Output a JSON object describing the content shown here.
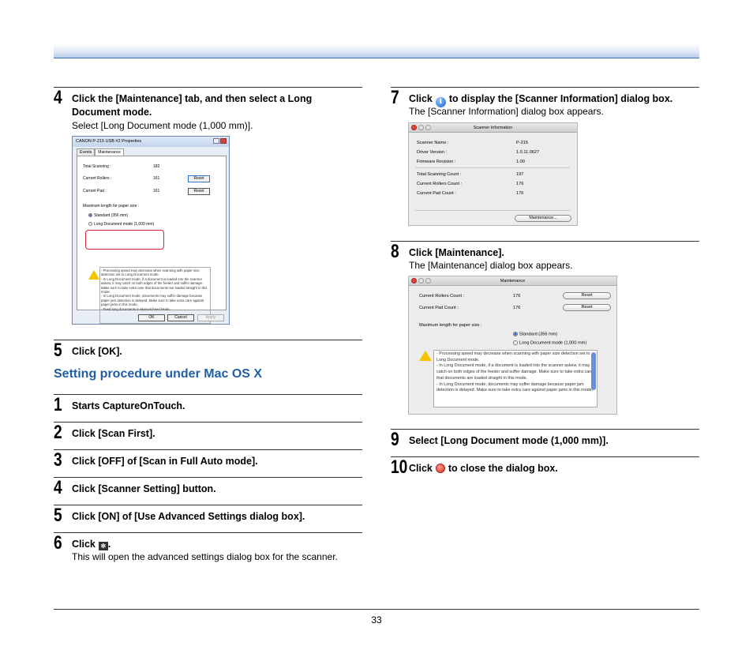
{
  "left_steps": [
    {
      "num": "4",
      "title": "Click the [Maintenance] tab, and then select a Long Document mode.",
      "desc": "Select [Long Document mode (1,000 mm)]."
    },
    {
      "num": "5",
      "title": "Click [OK]."
    }
  ],
  "section_heading": "Setting procedure under Mac OS X",
  "mac_steps": [
    {
      "num": "1",
      "title": "Starts CaptureOnTouch."
    },
    {
      "num": "2",
      "title": "Click [Scan First]."
    },
    {
      "num": "3",
      "title": "Click [OFF] of [Scan in Full Auto mode]."
    },
    {
      "num": "4",
      "title": "Click [Scanner Setting] button."
    },
    {
      "num": "5",
      "title": "Click [ON] of [Use Advanced Settings dialog box]."
    },
    {
      "num": "6",
      "title_prefix": "Click",
      "title_suffix": ".",
      "desc": "This will open the advanced settings dialog box for the scanner."
    }
  ],
  "right_steps": [
    {
      "num": "7",
      "title_prefix": "Click",
      "title_suffix": "to display the [Scanner Information] dialog box.",
      "desc": "The [Scanner Information] dialog box appears."
    },
    {
      "num": "8",
      "title": "Click [Maintenance].",
      "desc": "The [Maintenance] dialog box appears."
    },
    {
      "num": "9",
      "title": "Select [Long Document mode (1,000 mm)]."
    },
    {
      "num": "10",
      "title_prefix": "Click",
      "title_suffix": "to close the dialog box."
    }
  ],
  "win_dialog": {
    "title": "CANON P-215 USB #2 Properties",
    "tabs": [
      "Events",
      "Maintenance"
    ],
    "rows": [
      {
        "label": "Total Scanning :",
        "value": "182"
      },
      {
        "label": "Current Rollers :",
        "value": "161",
        "button": "Reset"
      },
      {
        "label": "Current Pad :",
        "value": "161",
        "button": "Reset"
      }
    ],
    "max_length_label": "Maximum length for paper size :",
    "radio_standard": "Standard (356 mm)",
    "radio_long": "Long Document mode (1,000 mm)",
    "warning": "- Processing speed may decrease when scanning with paper size detection set to Long Document mode.\n- In Long Document mode, if a document is loaded into the scanner askew, it may catch on both edges of the feeder and suffer damage. Make sure to take extra care that documents are loaded straight in this mode.\n- In Long Document mode, documents may suffer damage because paper jam detection is delayed. Make sure to take extra care against paper jams in this mode.\n- Feed long documents in Manual Feed Mode.",
    "ok": "OK",
    "cancel": "Cancel",
    "apply": "Apply"
  },
  "scanner_info": {
    "title": "Scanner Information",
    "rows": [
      {
        "label": "Scanner Name :",
        "value": "P-215"
      },
      {
        "label": "Driver Version :",
        "value": "1.0.11.0627"
      },
      {
        "label": "Firmware Revision :",
        "value": "1.00"
      },
      {
        "label": "Total Scanning Count :",
        "value": "197"
      },
      {
        "label": "Current Rollers Count :",
        "value": "176"
      },
      {
        "label": "Current Pad Count :",
        "value": "176"
      }
    ],
    "button": "Maintenance..."
  },
  "maintenance": {
    "title": "Maintenance",
    "rows": [
      {
        "label": "Current Rollers Count :",
        "value": "176",
        "button": "Reset"
      },
      {
        "label": "Current Pad Count :",
        "value": "176",
        "button": "Reset"
      }
    ],
    "max_length_label": "Maximum length for paper size :",
    "radio_standard": "Standard (356 mm)",
    "radio_long": "Long Document mode (1,000 mm)",
    "warning": "- Processing speed may decrease when scanning with paper size detection set to Long Document mode.\n- In Long Document mode, if a document is loaded into the scanner askew, it may catch on both edges of the feeder and suffer damage. Make sure to take extra care that documents are loaded straight in this mode.\n- In Long Document mode, documents may suffer damage because paper jam detection is delayed. Make sure to take extra care against paper jams in this mode."
  },
  "page_number": "33"
}
